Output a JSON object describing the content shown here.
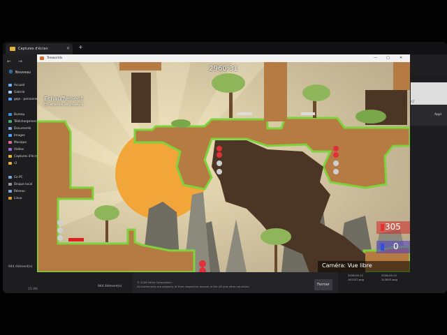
{
  "explorer": {
    "tab_title": "Captures d'écran",
    "new_label": "Nouveau",
    "sidebar": [
      {
        "label": "Accueil",
        "color": "#6fb0ff"
      },
      {
        "label": "Galerie",
        "color": "#9fd0ff"
      },
      {
        "label": "gojo - personnel",
        "color": "#4da3ff"
      },
      {
        "label": "Bureau",
        "color": "#3d8de0"
      },
      {
        "label": "Téléchargements",
        "color": "#3fae6a"
      },
      {
        "label": "Documents",
        "color": "#7aa7d8"
      },
      {
        "label": "Images",
        "color": "#4da3ff"
      },
      {
        "label": "Musique",
        "color": "#e06a9a"
      },
      {
        "label": "Vidéos",
        "color": "#9a6ae0"
      },
      {
        "label": "Captures d'écran",
        "color": "#e6b43c"
      },
      {
        "label": "r2",
        "color": "#e6b43c"
      },
      {
        "label": "Ce PC",
        "color": "#7aa7d8"
      },
      {
        "label": "Disque local",
        "color": "#999999"
      },
      {
        "label": "Réseau",
        "color": "#7aa7d8"
      },
      {
        "label": "Linux",
        "color": "#e0a030"
      }
    ],
    "element_count": "944 élément(s)",
    "element_count_2": "15 élé",
    "element_count_bottom": "944 élément(s)",
    "right_panel_apply": "Appl",
    "right_panel_text": "r2"
  },
  "dialog": {
    "copyright_line1": "© 2026 Valve Corporation.",
    "copyright_line2": "All trademarks are property of their respective owners in the US and other countries.",
    "close_label": "Fermer"
  },
  "files": [
    {
      "date": "2026-09-12",
      "name": "181107.png"
    },
    {
      "date": "2026-09-12",
      "name": "213843.png"
    }
  ],
  "game": {
    "window_title": "Teeworlds",
    "timer": "2960:31",
    "status": "Échauffement",
    "status_sub": "En attente de joueurs",
    "score_red": "305",
    "score_blue": "0",
    "camera_label": "Caméra: Vue libre",
    "colors": {
      "sky": "#c8b89a",
      "sun": "#f0a83a",
      "dirt": "#b57840",
      "dark_dirt": "#4a3424",
      "grass": "#7ed23c",
      "cliff": "#6b6a5f"
    }
  }
}
